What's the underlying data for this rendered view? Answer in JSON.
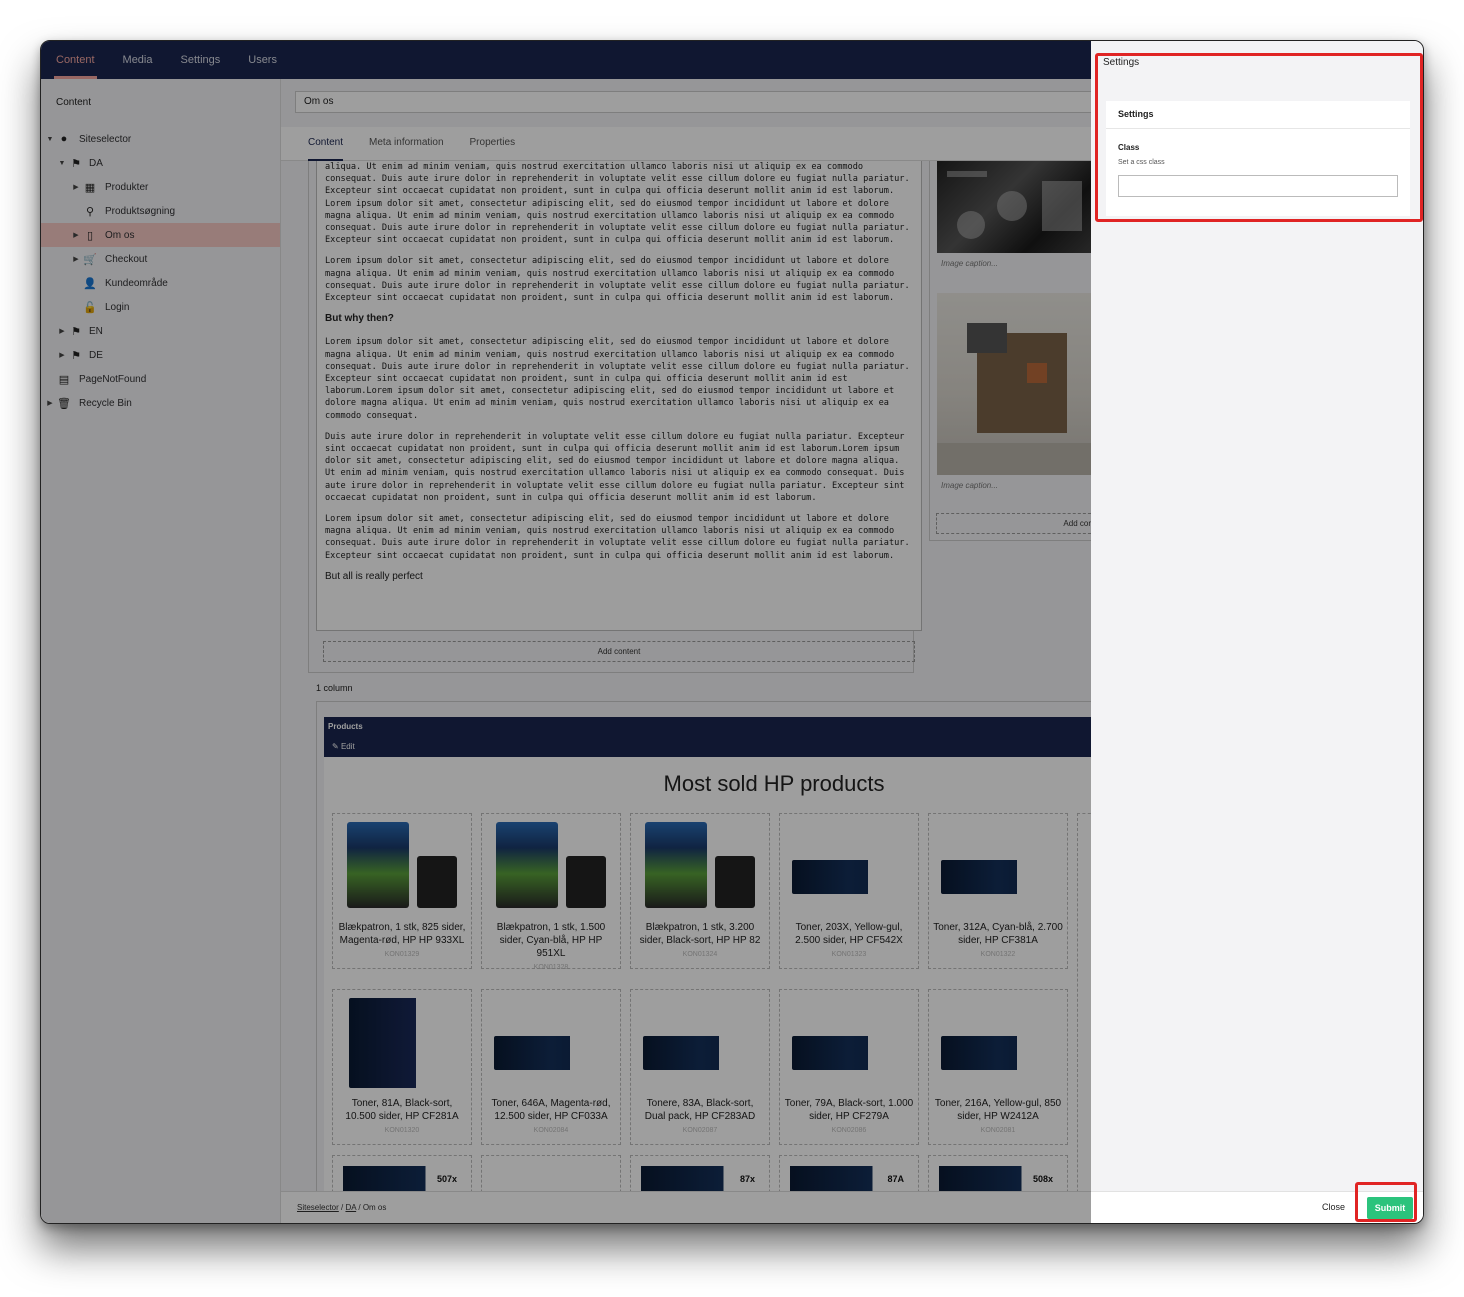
{
  "topnav": {
    "items": [
      "Content",
      "Media",
      "Settings",
      "Users"
    ]
  },
  "tree": {
    "title": "Content",
    "nodes": [
      {
        "label": "Siteselector",
        "icon": "globe-icon"
      },
      {
        "label": "DA",
        "icon": "flag-icon"
      },
      {
        "label": "Produkter",
        "icon": "grid-icon"
      },
      {
        "label": "Produktsøgning",
        "icon": "search-icon"
      },
      {
        "label": "Om os",
        "icon": "document-icon"
      },
      {
        "label": "Checkout",
        "icon": "cart-icon"
      },
      {
        "label": "Kundeområde",
        "icon": "user-icon"
      },
      {
        "label": "Login",
        "icon": "unlock-icon"
      },
      {
        "label": "EN",
        "icon": "flag-icon"
      },
      {
        "label": "DE",
        "icon": "flag-icon"
      },
      {
        "label": "PageNotFound",
        "icon": "archive-icon"
      },
      {
        "label": "Recycle Bin",
        "icon": "trash-icon"
      }
    ]
  },
  "editor": {
    "page_name": "Om os",
    "tabs": [
      "Content",
      "Meta information",
      "Properties"
    ],
    "paragraphs": [
      "aliqua. Ut enim ad minim veniam, quis nostrud exercitation ullamco laboris nisi ut aliquip ex ea commodo consequat. Duis aute irure dolor in reprehenderit in voluptate velit esse cillum dolore eu fugiat nulla pariatur. Excepteur sint occaecat cupidatat non proident, sunt in culpa qui officia deserunt mollit anim id est laborum. Lorem ipsum dolor sit amet, consectetur adipiscing elit, sed do eiusmod tempor incididunt ut labore et dolore magna aliqua. Ut enim ad minim veniam, quis nostrud exercitation ullamco laboris nisi ut aliquip ex ea commodo consequat. Duis aute irure dolor in reprehenderit in voluptate velit esse cillum dolore eu fugiat nulla pariatur. Excepteur sint occaecat cupidatat non proident, sunt in culpa qui officia deserunt mollit anim id est laborum.",
      "Lorem ipsum dolor sit amet, consectetur adipiscing elit, sed do eiusmod tempor incididunt ut labore et dolore magna aliqua. Ut enim ad minim veniam, quis nostrud exercitation ullamco laboris nisi ut aliquip ex ea commodo consequat. Duis aute irure dolor in reprehenderit in voluptate velit esse cillum dolore eu fugiat nulla pariatur. Excepteur sint occaecat cupidatat non proident, sunt in culpa qui officia deserunt mollit anim id est laborum.",
      "Lorem ipsum dolor sit amet, consectetur adipiscing elit, sed do eiusmod tempor incididunt ut labore et dolore magna aliqua. Ut enim ad minim veniam, quis nostrud exercitation ullamco laboris nisi ut aliquip ex ea commodo consequat. Duis aute irure dolor in reprehenderit in voluptate velit esse cillum dolore eu fugiat nulla pariatur. Excepteur sint occaecat cupidatat non proident, sunt in culpa qui officia deserunt mollit anim id est laborum.Lorem ipsum dolor sit amet, consectetur adipiscing elit, sed do eiusmod tempor incididunt ut labore et dolore magna aliqua. Ut enim ad minim veniam, quis nostrud exercitation ullamco laboris nisi ut aliquip ex ea commodo consequat.",
      "Duis aute irure dolor in reprehenderit in voluptate velit esse cillum dolore eu fugiat nulla pariatur. Excepteur sint occaecat cupidatat non proident, sunt in culpa qui officia deserunt mollit anim id est laborum.Lorem ipsum dolor sit amet, consectetur adipiscing elit, sed do eiusmod tempor incididunt ut labore et dolore magna aliqua. Ut enim ad minim veniam, quis nostrud exercitation ullamco laboris nisi ut aliquip ex ea commodo consequat. Duis aute irure dolor in reprehenderit in voluptate velit esse cillum dolore eu fugiat nulla pariatur. Excepteur sint occaecat cupidatat non proident, sunt in culpa qui officia deserunt mollit anim id est laborum.",
      "Lorem ipsum dolor sit amet, consectetur adipiscing elit, sed do eiusmod tempor incididunt ut labore et dolore magna aliqua. Ut enim ad minim veniam, quis nostrud exercitation ullamco laboris nisi ut aliquip ex ea commodo consequat. Duis aute irure dolor in reprehenderit in voluptate velit esse cillum dolore eu fugiat nulla pariatur. Excepteur sint occaecat cupidatat non proident, sunt in culpa qui officia deserunt mollit anim id est laborum."
    ],
    "heading": "But why then?",
    "closing": "But all is really perfect",
    "add_content": "Add content",
    "add_content_truncated": "Add cor",
    "image_caption": "Image caption...",
    "column_label": "1 column",
    "products_block": {
      "title_bar": "Products",
      "edit": "Edit",
      "heading": "Most sold HP products",
      "items": [
        {
          "name": "Blækpatron, 1 stk, 825 sider, Magenta-rød, HP HP 933XL",
          "sku": "KON01329",
          "art": "ink-933"
        },
        {
          "name": "Blækpatron, 1 stk, 1.500 sider, Cyan-blå, HP HP 951XL",
          "sku": "KON01328",
          "art": "ink-951"
        },
        {
          "name": "Blækpatron, 1 stk, 3.200 sider, Black-sort, HP HP 82",
          "sku": "KON01324",
          "art": "ink-82"
        },
        {
          "name": "Toner, 203X, Yellow-gul, 2.500 sider, HP CF542X",
          "sku": "KON01323",
          "art": "toner"
        },
        {
          "name": "Toner, 312A, Cyan-blå, 2.700 sider, HP CF381A",
          "sku": "KON01322",
          "art": "toner"
        },
        {
          "name": "Toner, 81A, Black-sort, 10.500 sider, HP CF281A",
          "sku": "KON01320",
          "art": "toner-tall"
        },
        {
          "name": "Toner, 646A, Magenta-rød, 12.500 sider, HP CF033A",
          "sku": "KON02084",
          "art": "toner"
        },
        {
          "name": "Tonere, 83A, Black-sort, Dual pack, HP CF283AD",
          "sku": "KON02087",
          "art": "toner"
        },
        {
          "name": "Toner, 79A, Black-sort, 1.000 sider, HP CF279A",
          "sku": "KON02086",
          "art": "toner"
        },
        {
          "name": "Toner, 216A, Yellow-gul, 850 sider, HP W2412A",
          "sku": "KON02081",
          "art": "toner"
        }
      ],
      "partial_labels": [
        "507x",
        "87x",
        "87A",
        "508x"
      ]
    },
    "breadcrumb": [
      "Siteselector",
      "DA",
      "Om os"
    ]
  },
  "panel": {
    "title": "Settings",
    "section_title": "Settings",
    "field_label": "Class",
    "field_desc": "Set a css class",
    "field_value": "",
    "close": "Close",
    "submit": "Submit"
  },
  "colors": {
    "nav": "#1b264f",
    "active": "#f5a6a0",
    "submit": "#2bc37c",
    "highlight": "#e02424"
  }
}
